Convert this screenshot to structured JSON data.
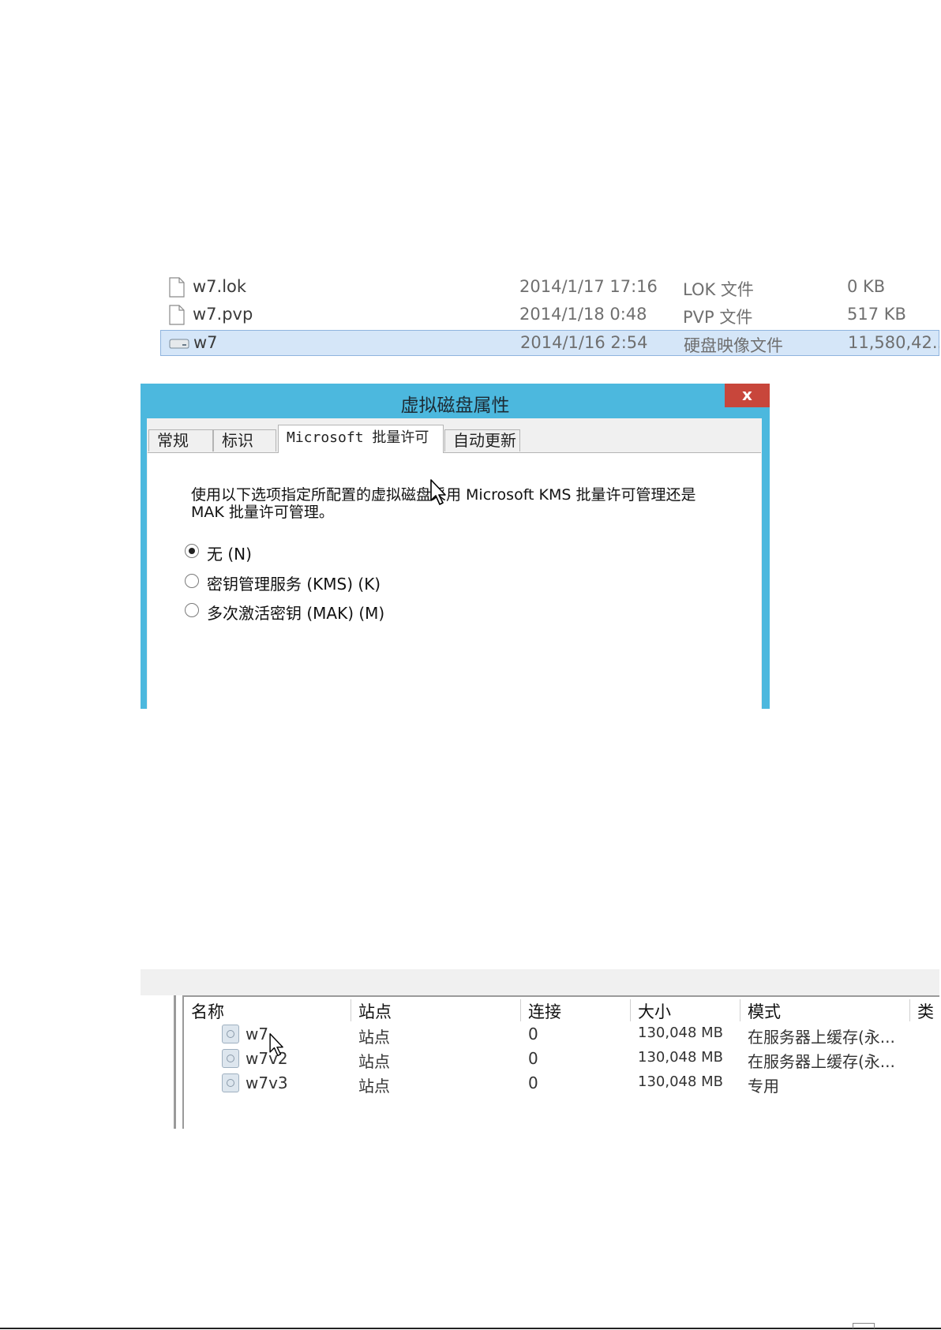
{
  "file_list": {
    "rows": [
      {
        "name": "w7.lok",
        "date": "2014/1/17 17:16",
        "type": "LOK 文件",
        "size": "0 KB",
        "icon": "document-icon",
        "selected": false
      },
      {
        "name": "w7.pvp",
        "date": "2014/1/18 0:48",
        "type": "PVP 文件",
        "size": "517 KB",
        "icon": "document-icon",
        "selected": false
      },
      {
        "name": "w7",
        "date": "2014/1/16 2:54",
        "type": "硬盘映像文件",
        "size": "11,580,42...",
        "icon": "disk-image-icon",
        "selected": true
      }
    ]
  },
  "dialog": {
    "title": "虚拟磁盘属性",
    "close_label": "x",
    "tabs": [
      {
        "label": "常规",
        "active": false
      },
      {
        "label": "标识",
        "active": false
      },
      {
        "label": "Microsoft 批量许可",
        "active": true
      },
      {
        "label": "自动更新",
        "active": false
      }
    ],
    "description": "使用以下选项指定所配置的虚拟磁盘采用 Microsoft KMS 批量许可管理还是 MAK 批量许可管理。",
    "options": [
      {
        "label": "无 (N)",
        "checked": true
      },
      {
        "label": "密钥管理服务 (KMS) (K)",
        "checked": false
      },
      {
        "label": "多次激活密钥 (MAK) (M)",
        "checked": false
      }
    ]
  },
  "disk_list": {
    "columns": [
      "名称",
      "站点",
      "连接",
      "大小",
      "模式",
      "类"
    ],
    "rows": [
      {
        "name": "w7",
        "site": "站点",
        "connections": "0",
        "size": "130,048 MB",
        "mode": "在服务器上缓存(永..."
      },
      {
        "name": "w7v2",
        "site": "站点",
        "connections": "0",
        "size": "130,048 MB",
        "mode": "在服务器上缓存(永..."
      },
      {
        "name": "w7v3",
        "site": "站点",
        "connections": "0",
        "size": "130,048 MB",
        "mode": "专用"
      }
    ]
  },
  "colors": {
    "dialog_frame": "#4cb8de",
    "close_button": "#c8463b",
    "selection": "#d5e6f8"
  }
}
